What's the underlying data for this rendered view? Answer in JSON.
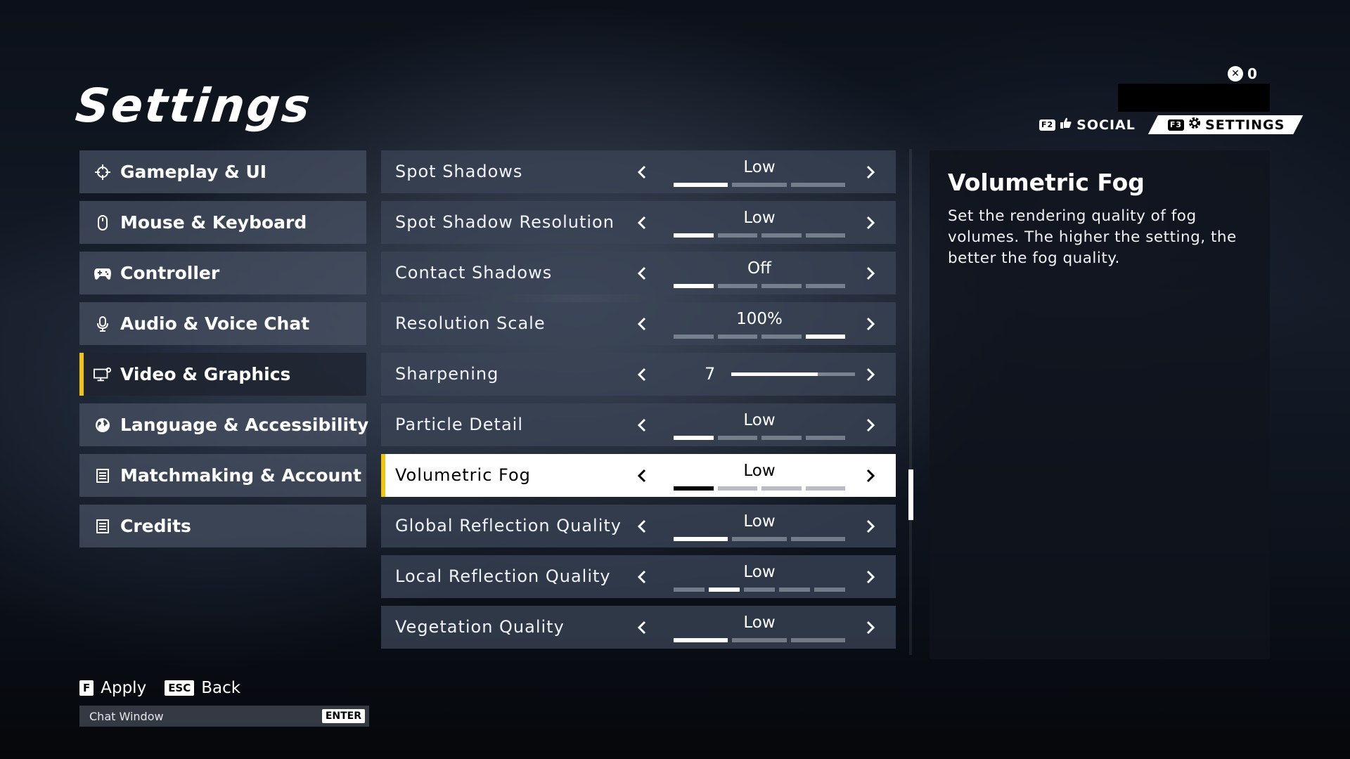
{
  "header": {
    "title": "Settings",
    "currency_amount": "0",
    "tabs": [
      {
        "key": "F2",
        "label": "SOCIAL",
        "active": false
      },
      {
        "key": "F3",
        "label": "SETTINGS",
        "active": true
      }
    ]
  },
  "sidebar": {
    "items": [
      {
        "label": "Gameplay & UI",
        "icon": "crosshair-icon",
        "active": false
      },
      {
        "label": "Mouse & Keyboard",
        "icon": "mouse-icon",
        "active": false
      },
      {
        "label": "Controller",
        "icon": "gamepad-icon",
        "active": false
      },
      {
        "label": "Audio & Voice Chat",
        "icon": "microphone-icon",
        "active": false
      },
      {
        "label": "Video & Graphics",
        "icon": "monitor-icon",
        "active": true
      },
      {
        "label": "Language & Accessibility",
        "icon": "globe-icon",
        "active": false
      },
      {
        "label": "Matchmaking & Account",
        "icon": "list-icon",
        "active": false
      },
      {
        "label": "Credits",
        "icon": "list-icon",
        "active": false
      }
    ]
  },
  "settings": {
    "rows": [
      {
        "label": "Spot Shadows",
        "value": "Low",
        "level": 1,
        "levels": 3
      },
      {
        "label": "Spot Shadow Resolution",
        "value": "Low",
        "level": 1,
        "levels": 4
      },
      {
        "label": "Contact Shadows",
        "value": "Off",
        "level": 1,
        "levels": 4
      },
      {
        "label": "Resolution Scale",
        "value": "100%",
        "level": 4,
        "levels": 4
      },
      {
        "label": "Sharpening",
        "value": "7",
        "slider_fraction": 0.7
      },
      {
        "label": "Particle Detail",
        "value": "Low",
        "level": 1,
        "levels": 4
      },
      {
        "label": "Volumetric Fog",
        "value": "Low",
        "level": 1,
        "levels": 4,
        "selected": true
      },
      {
        "label": "Global Reflection Quality",
        "value": "Low",
        "level": 1,
        "levels": 3
      },
      {
        "label": "Local Reflection Quality",
        "value": "Low",
        "level": 2,
        "levels": 5
      },
      {
        "label": "Vegetation Quality",
        "value": "Low",
        "level": 1,
        "levels": 3
      }
    ]
  },
  "description": {
    "title": "Volumetric Fog",
    "text": "Set the rendering quality of fog volumes. The higher the setting, the better the fog quality."
  },
  "footer": {
    "apply_key": "F",
    "apply_label": "Apply",
    "back_key": "ESC",
    "back_label": "Back",
    "chat_label": "Chat Window",
    "chat_key": "ENTER"
  },
  "colors": {
    "accent": "#f1c40f",
    "panel": "#3a4456",
    "selected_row": "#ffffff"
  }
}
